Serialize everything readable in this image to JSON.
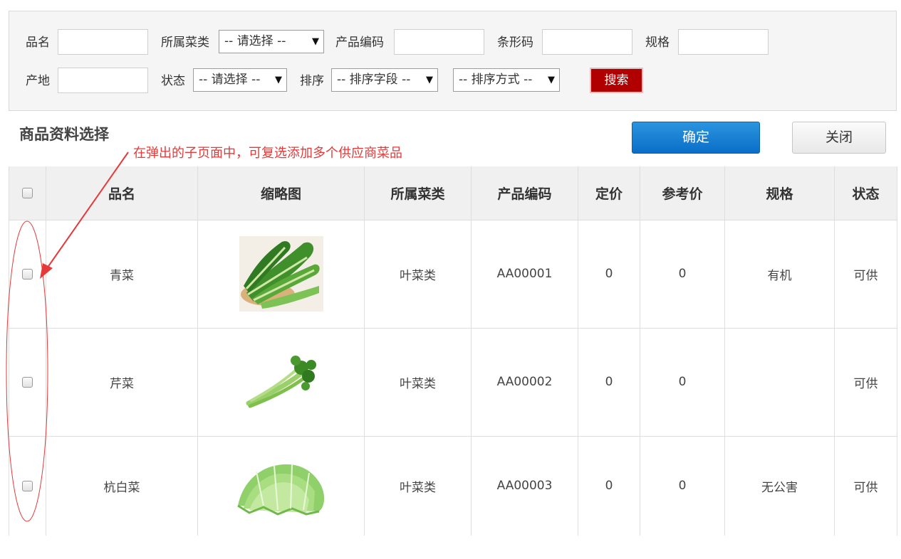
{
  "search": {
    "name_label": "品名",
    "category_label": "所属菜类",
    "category_value": "-- 请选择 --",
    "code_label": "产品编码",
    "barcode_label": "条形码",
    "spec_label": "规格",
    "origin_label": "产地",
    "status_label": "状态",
    "status_value": "-- 请选择 --",
    "sort_label": "排序",
    "sort_field_value": "-- 排序字段 --",
    "sort_order_value": "-- 排序方式 --",
    "search_button": "搜索"
  },
  "title": "商品资料选择",
  "annotation": "在弹出的子页面中，可复选添加多个供应商菜品",
  "actions": {
    "ok": "确定",
    "close": "关闭"
  },
  "table": {
    "columns": [
      "品名",
      "缩略图",
      "所属菜类",
      "产品编码",
      "定价",
      "参考价",
      "规格",
      "状态"
    ],
    "rows": [
      {
        "name": "青菜",
        "category": "叶菜类",
        "code": "AA00001",
        "price": "0",
        "ref_price": "0",
        "spec": "有机",
        "status": "可供",
        "thumb_icon": "bok-choy-image"
      },
      {
        "name": "芹菜",
        "category": "叶菜类",
        "code": "AA00002",
        "price": "0",
        "ref_price": "0",
        "spec": "",
        "status": "可供",
        "thumb_icon": "celery-image"
      },
      {
        "name": "杭白菜",
        "category": "叶菜类",
        "code": "AA00003",
        "price": "0",
        "ref_price": "0",
        "spec": "无公害",
        "status": "可供",
        "thumb_icon": "cabbage-image"
      }
    ]
  },
  "colors": {
    "search_button": "#b00000",
    "ok_button": "#1a80d4",
    "annotation": "#e53a3a"
  }
}
